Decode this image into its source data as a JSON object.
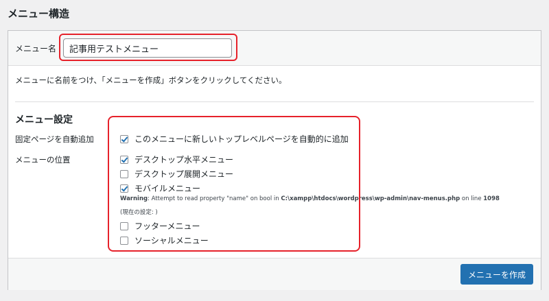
{
  "page": {
    "title": "メニュー構造"
  },
  "menu_name": {
    "label": "メニュー名",
    "value": "記事用テストメニュー"
  },
  "instruction": "メニューに名前をつけ、「メニューを作成」ボタンをクリックしてください。",
  "settings": {
    "heading": "メニュー設定",
    "auto_add": {
      "label": "固定ページを自動追加",
      "option": {
        "label": "このメニューに新しいトップレベルページを自動的に追加",
        "checked": true
      }
    },
    "locations": {
      "label": "メニューの位置",
      "options": [
        {
          "label": "デスクトップ水平メニュー",
          "checked": true
        },
        {
          "label": "デスクトップ展開メニュー",
          "checked": false
        },
        {
          "label": "モバイルメニュー",
          "checked": true
        },
        {
          "label": "フッターメニュー",
          "checked": false
        },
        {
          "label": "ソーシャルメニュー",
          "checked": false
        }
      ],
      "warning": {
        "prefix": "Warning",
        "message": ": Attempt to read property \"name\" on bool in ",
        "path": "C:\\xampp\\htdocs\\wordpress\\wp-admin\\nav-menus.php",
        "line_text": " on line ",
        "line": "1098"
      },
      "current_setting": "(現在の設定: )"
    }
  },
  "footer": {
    "create_button": "メニューを作成"
  },
  "colors": {
    "accent": "#2271b1",
    "highlight": "#e6212a"
  }
}
